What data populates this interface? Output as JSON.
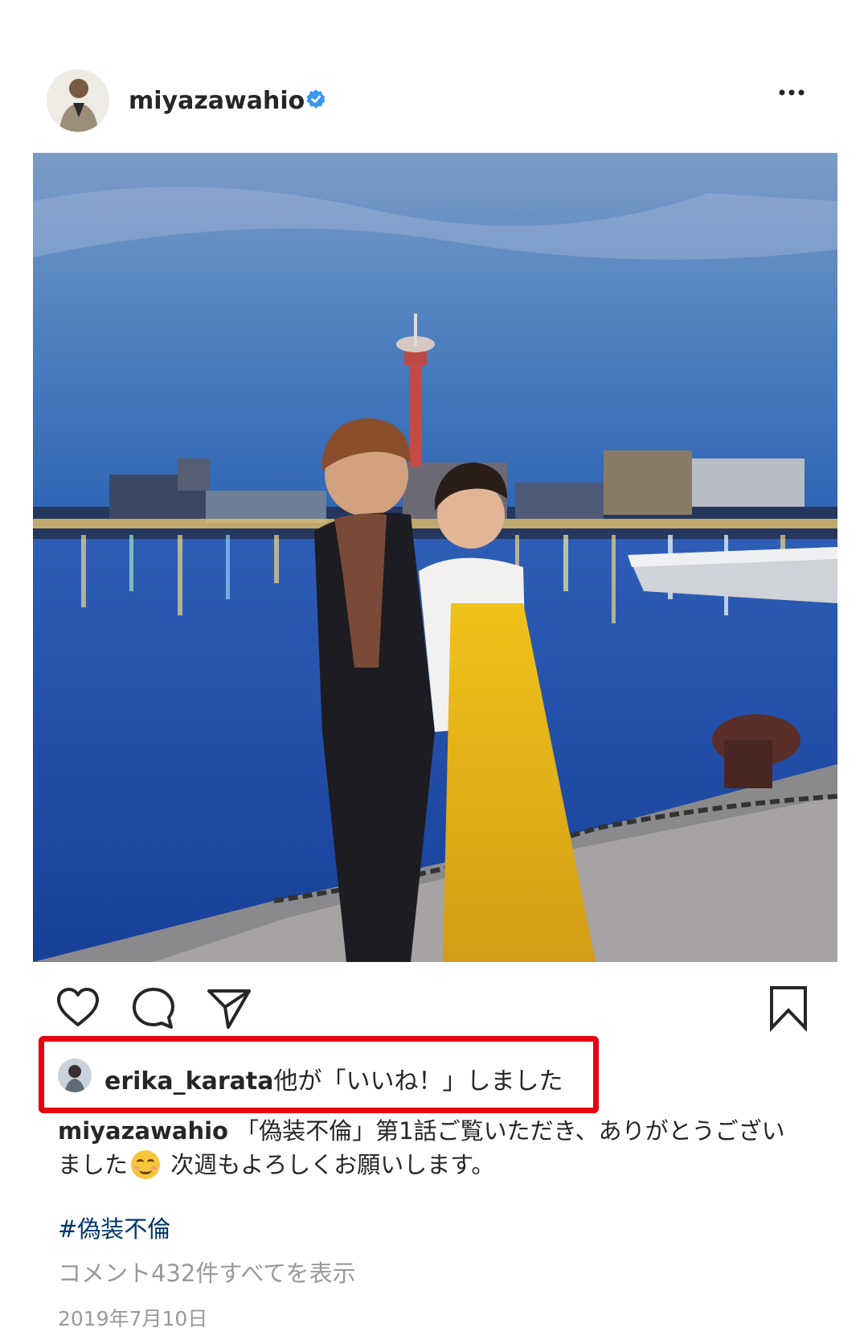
{
  "post": {
    "author": {
      "username": "miyazawahio",
      "verified": true,
      "avatar_icon": "profile-photo"
    },
    "menu_icon": "more-options-icon",
    "image": {
      "description_icon": "harbor-night-photo"
    },
    "actions": {
      "like_icon": "heart-icon",
      "comment_icon": "comment-bubble-icon",
      "share_icon": "paper-plane-icon",
      "save_icon": "bookmark-icon"
    },
    "likes": {
      "user": "erika_karata",
      "suffix": "他が「いいね！」しました"
    },
    "caption": {
      "username": "miyazawahio",
      "text_before_emoji": "「偽装不倫」第1話ご覧いただき、ありがとうございました",
      "text_after_emoji": "次週もよろしくお願いします。"
    },
    "hashtag": "#偽装不倫",
    "view_comments": "コメント432件すべてを表示",
    "date": "2019年7月10日"
  },
  "colors": {
    "highlight_border": "#e60012",
    "verified_badge": "#3897f0",
    "hashtag": "#003569",
    "muted_text": "#999999"
  }
}
